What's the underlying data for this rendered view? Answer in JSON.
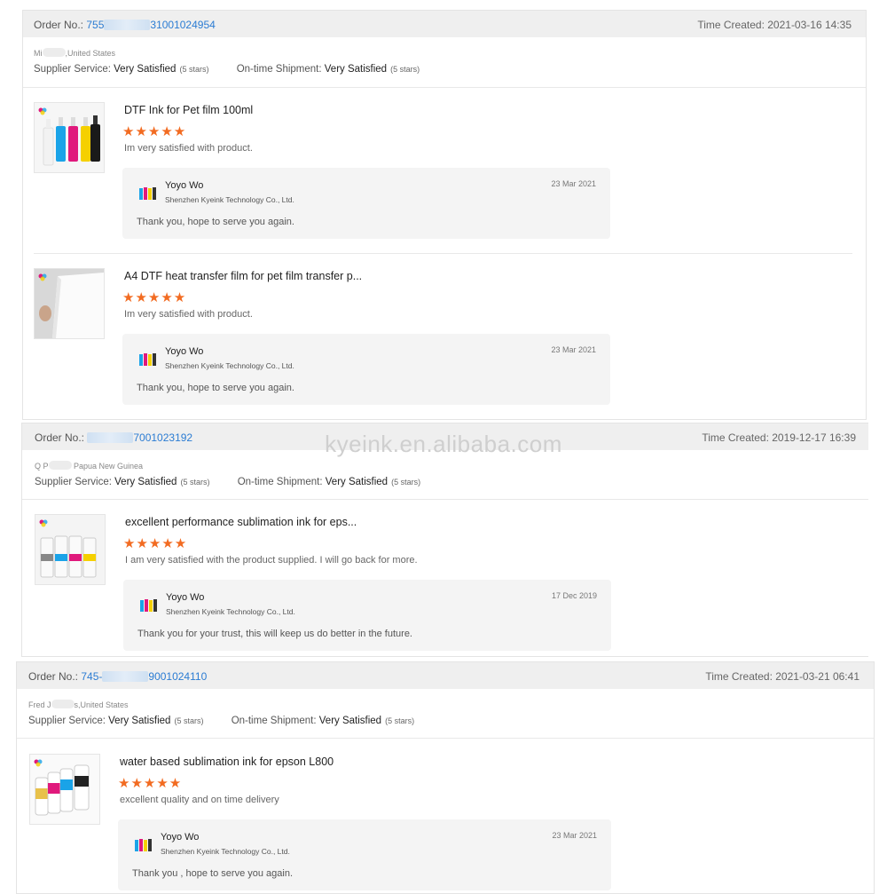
{
  "icons": {
    "brand_logo": "kyeink-logo-icon",
    "star": "star-icon",
    "avatar": "ink-bottles-avatar-icon"
  },
  "colors": {
    "star": "#f26b21",
    "order_link": "#2b7cd3",
    "header_bg": "#efefef",
    "reply_bg": "#f4f4f4"
  },
  "watermark": "kyeink.en.alibaba.com",
  "orders": [
    {
      "order_label": "Order No.:",
      "order_prefix": "755",
      "order_suffix": "31001024954",
      "time_created": "Time Created: 2021-03-16 14:35",
      "buyer_prefix": "Mi",
      "buyer_suffix": ",United States",
      "supplier_label": "Supplier Service:",
      "supplier_value": "Very Satisfied",
      "supplier_stars": "(5 stars)",
      "shipment_label": "On-time Shipment:",
      "shipment_value": "Very Satisfied",
      "shipment_stars": "(5 stars)",
      "items": [
        {
          "title": "DTF Ink for Pet film 100ml",
          "stars": "★★★★★",
          "rating": 5,
          "review": "Im very satisfied with product.",
          "reply": {
            "name": "Yoyo Wo",
            "company": "Shenzhen Kyeink Technology Co., Ltd.",
            "date": "23 Mar 2021",
            "text": "Thank you, hope to serve you again."
          }
        },
        {
          "title": "A4 DTF heat transfer film for pet film transfer p...",
          "stars": "★★★★★",
          "rating": 5,
          "review": "Im very satisfied with product.",
          "reply": {
            "name": "Yoyo Wo",
            "company": "Shenzhen Kyeink Technology Co., Ltd.",
            "date": "23 Mar 2021",
            "text": "Thank you, hope to serve you again."
          }
        }
      ]
    },
    {
      "order_label": "Order No.:",
      "order_prefix": "",
      "order_suffix": "7001023192",
      "time_created": "Time Created: 2019-12-17 16:39",
      "buyer_prefix": "Q P",
      "buyer_suffix": " Papua New Guinea",
      "supplier_label": "Supplier Service:",
      "supplier_value": "Very Satisfied",
      "supplier_stars": "(5 stars)",
      "shipment_label": "On-time Shipment:",
      "shipment_value": "Very Satisfied",
      "shipment_stars": "(5 stars)",
      "items": [
        {
          "title": "excellent performance sublimation ink for eps...",
          "stars": "★★★★★",
          "rating": 5,
          "review": "I am very satisfied with the product supplied. I will go back for more.",
          "reply": {
            "name": "Yoyo Wo",
            "company": "Shenzhen Kyeink Technology Co., Ltd.",
            "date": "17 Dec 2019",
            "text": "Thank you for your trust,  this will keep us do better in the future."
          }
        }
      ]
    },
    {
      "order_label": "Order No.:",
      "order_prefix": "745-",
      "order_suffix": "9001024110",
      "time_created": "Time Created: 2021-03-21 06:41",
      "buyer_prefix": "Fred J",
      "buyer_suffix": "s,United States",
      "supplier_label": "Supplier Service:",
      "supplier_value": "Very Satisfied",
      "supplier_stars": "(5 stars)",
      "shipment_label": "On-time Shipment:",
      "shipment_value": "Very Satisfied",
      "shipment_stars": "(5 stars)",
      "items": [
        {
          "title": "water based sublimation ink for epson L800",
          "stars": "★★★★★",
          "rating": 5,
          "review": "excellent quality and on time delivery",
          "reply": {
            "name": "Yoyo Wo",
            "company": "Shenzhen Kyeink Technology Co., Ltd.",
            "date": "23 Mar 2021",
            "text": "Thank you , hope to serve you again."
          }
        }
      ]
    }
  ]
}
